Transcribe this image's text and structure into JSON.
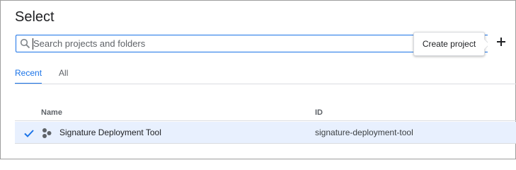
{
  "dialog": {
    "title": "Select"
  },
  "search": {
    "placeholder": "Search projects and folders",
    "value": ""
  },
  "tooltip": {
    "text": "Create project"
  },
  "tabs": [
    {
      "label": "Recent",
      "active": true
    },
    {
      "label": "All",
      "active": false
    }
  ],
  "table": {
    "columns": [
      "Name",
      "ID"
    ],
    "rows": [
      {
        "selected": true,
        "name": "Signature Deployment Tool",
        "id": "signature-deployment-tool"
      }
    ]
  },
  "icons": {
    "search": "search-icon",
    "add": "plus-icon",
    "check": "checkmark-icon",
    "project": "project-hexagon-icon"
  },
  "colors": {
    "accent": "#1a73e8",
    "selected_row": "#e8f0fe",
    "text": "#202124",
    "muted": "#5f6368"
  }
}
